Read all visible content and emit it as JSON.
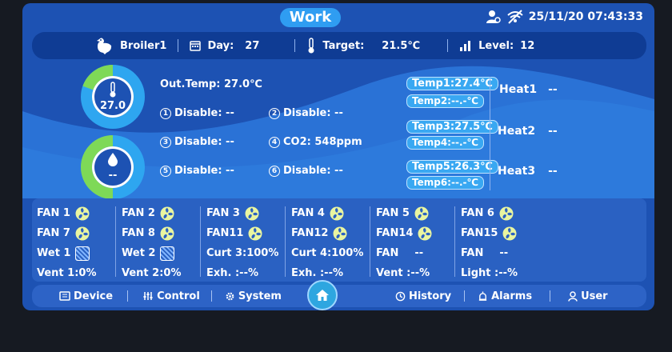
{
  "header": {
    "title": "Work",
    "datetime": "25/11/20 07:43:33"
  },
  "infobar": {
    "house": "Broiler1",
    "day_label": "Day:",
    "day_value": "27",
    "target_label": "Target:",
    "target_value": "21.5℃",
    "level_label": "Level:",
    "level_value": "12"
  },
  "sensors": {
    "temp_ring_value": "27.0",
    "humidity_ring_value": "--",
    "out_temp": "Out.Temp: 27.0℃",
    "slots": [
      {
        "num": "1",
        "text": "Disable: --"
      },
      {
        "num": "2",
        "text": "Disable: --"
      },
      {
        "num": "3",
        "text": "Disable: --"
      },
      {
        "num": "4",
        "text": "CO2: 548ppm"
      },
      {
        "num": "5",
        "text": "Disable: --"
      },
      {
        "num": "6",
        "text": "Disable: --"
      }
    ]
  },
  "temps": [
    {
      "label": "Temp1:",
      "value": "27.4℃"
    },
    {
      "label": "Temp2:",
      "value": "--.-℃"
    },
    {
      "label": "Temp3:",
      "value": "27.5℃"
    },
    {
      "label": "Temp4:",
      "value": "--.-℃"
    },
    {
      "label": "Temp5:",
      "value": "26.3℃"
    },
    {
      "label": "Temp6:",
      "value": "--.-℃"
    }
  ],
  "heaters": [
    {
      "label": "Heat1",
      "value": "--"
    },
    {
      "label": "Heat2",
      "value": "--"
    },
    {
      "label": "Heat3",
      "value": "--"
    }
  ],
  "fan_columns": [
    {
      "r1": "FAN 1",
      "r2": "FAN 7",
      "r3": "Wet  1",
      "r4": "Vent 1:0%"
    },
    {
      "r1": "FAN 2",
      "r2": "FAN 8",
      "r3": "Wet  2",
      "r4": "Vent 2:0%"
    },
    {
      "r1": "FAN 3",
      "r2": "FAN11",
      "r3": "Curt 3:100%",
      "r4": "Exh. :--%"
    },
    {
      "r1": "FAN 4",
      "r2": "FAN12",
      "r3": "Curt 4:100%",
      "r4": "Exh. :--%"
    },
    {
      "r1": "FAN 5",
      "r2": "FAN14",
      "r3": "FAN",
      "r3b": "--",
      "r4": "Vent :--%"
    },
    {
      "r1": "FAN 6",
      "r2": "FAN15",
      "r3": "FAN",
      "r3b": "--",
      "r4": "Light :--%"
    }
  ],
  "nav": {
    "device": "Device",
    "control": "Control",
    "system": "System",
    "history": "History",
    "alarms": "Alarms",
    "user": "User"
  },
  "colors": {
    "background": "#1d52b3",
    "wave": "#2a72d6",
    "ring_green": "#7ed957",
    "ring_blue": "#2ea6f0",
    "pill": "#39a8f2"
  }
}
